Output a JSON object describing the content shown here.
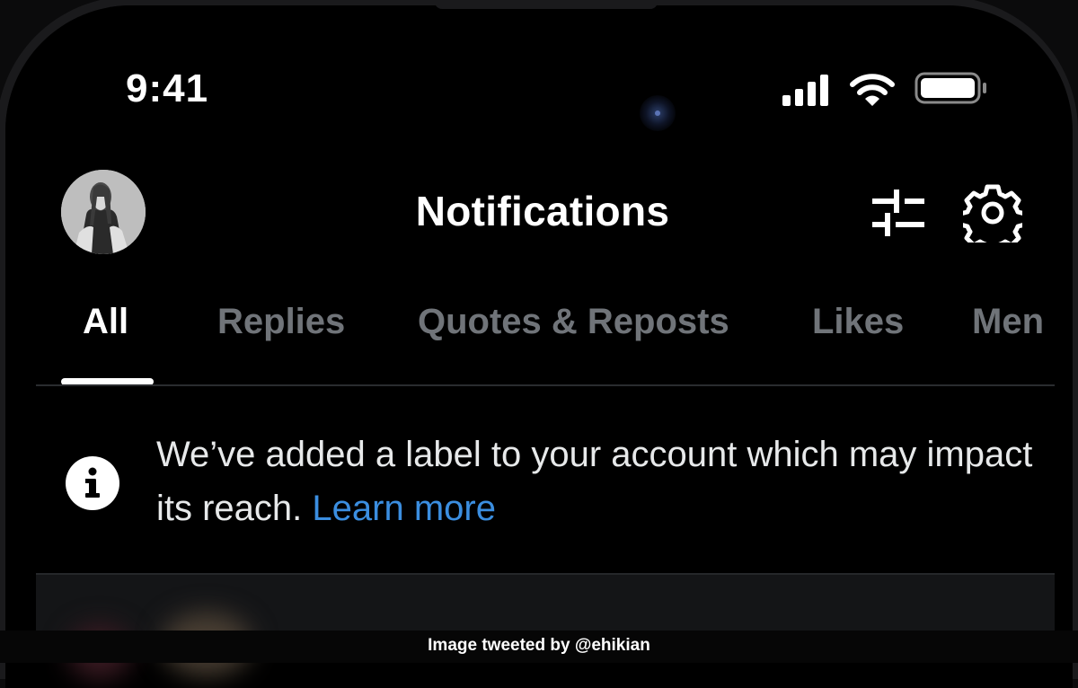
{
  "status_bar": {
    "time": "9:41",
    "icons": [
      "cellular-signal-icon",
      "wifi-icon",
      "battery-icon"
    ]
  },
  "header": {
    "title": "Notifications",
    "icons": [
      "avatar",
      "filter-sliders-icon",
      "gear-icon"
    ]
  },
  "tabs": [
    {
      "label": "All",
      "active": true
    },
    {
      "label": "Replies",
      "active": false
    },
    {
      "label": "Quotes & Reposts",
      "active": false
    },
    {
      "label": "Likes",
      "active": false
    },
    {
      "label": "Mentions",
      "active": false,
      "visible_text": "Men"
    }
  ],
  "notice": {
    "icon": "info-icon",
    "text": "We’ve added a label to your account which may impact its reach.",
    "link": "Learn more"
  },
  "caption": "Image tweeted by @ehikian",
  "colors": {
    "background": "#000000",
    "tab_inactive": "#707479",
    "link": "#3b8ee0",
    "text": "#e7e9ea"
  }
}
